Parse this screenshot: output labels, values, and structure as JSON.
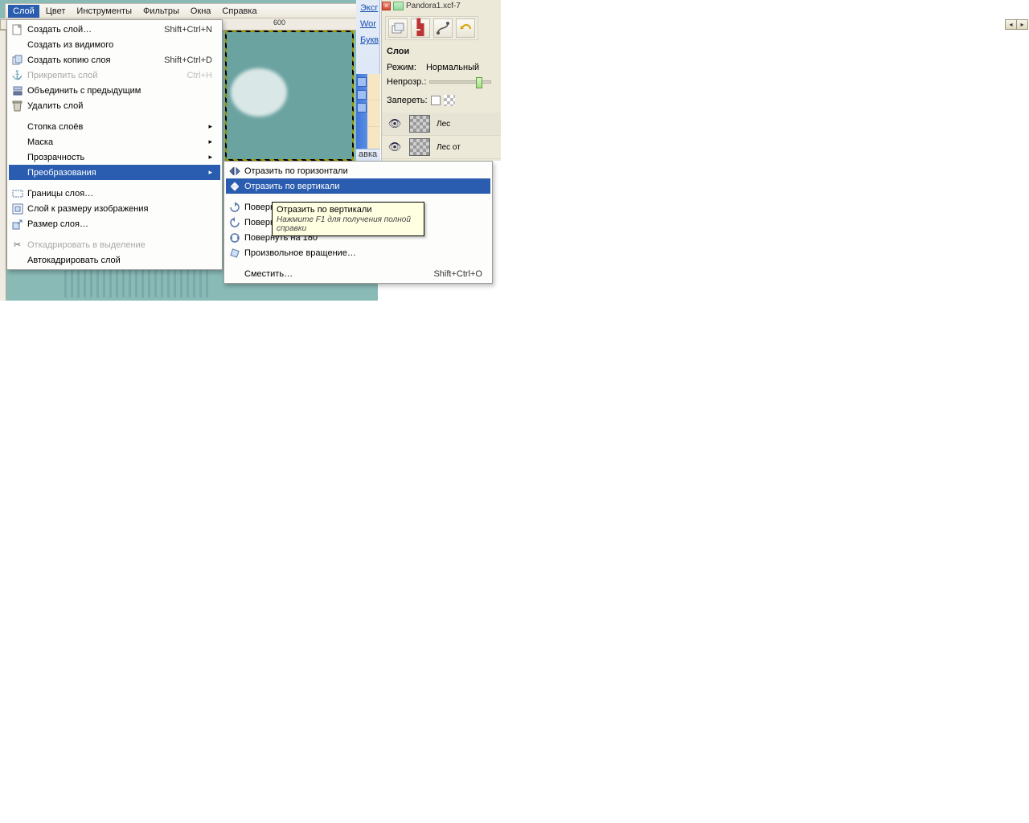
{
  "title_doc": "Pandora1.xcf-7",
  "ruler_mark": "600",
  "menubar": {
    "layer": "Слой",
    "color": "Цвет",
    "tools": "Инструменты",
    "filters": "Фильтры",
    "windows": "Окна",
    "help": "Справка"
  },
  "menu_layer": {
    "new_layer": "Создать слой…",
    "new_layer_sc": "Shift+Ctrl+N",
    "from_visible": "Создать из видимого",
    "duplicate": "Создать копию слоя",
    "duplicate_sc": "Shift+Ctrl+D",
    "anchor": "Прикрепить слой",
    "anchor_sc": "Ctrl+H",
    "merge_down": "Объединить с предыдущим",
    "delete": "Удалить слой",
    "stack": "Стопка слоёв",
    "mask": "Маска",
    "transparency": "Прозрачность",
    "transform": "Преобразования",
    "boundary": "Границы слоя…",
    "to_image_size": "Слой к размеру изображения",
    "scale": "Размер слоя…",
    "crop_to_sel": "Откадрировать в выделение",
    "autocrop": "Автокадрировать слой"
  },
  "menu_transform": {
    "flip_h": "Отразить по горизонтали",
    "flip_v": "Отразить по вертикали",
    "rot_cw": "Повернуть на 90° по часовой стрелке",
    "rot_ccw": "Повернуть на 90° против часовой стрелки",
    "rot_180": "Повернуть на 180°",
    "arbitrary": "Произвольное вращение…",
    "offset": "Сместить…",
    "offset_sc": "Shift+Ctrl+O"
  },
  "tooltip": {
    "title": "Отразить по вертикали",
    "hint": "Нажмите F1 для получения полной справки"
  },
  "browser_sidebar": {
    "l1": "Эксг",
    "l2": "Wor",
    "l3": "Букв",
    "footer": "авка"
  },
  "panel": {
    "section": "Слои",
    "mode_lbl": "Режим:",
    "mode_val": "Нормальный",
    "opacity_lbl": "Непрозр.:",
    "lock_lbl": "Запереть:",
    "layers": [
      {
        "name": "Лес"
      },
      {
        "name": "Лес от"
      }
    ]
  }
}
